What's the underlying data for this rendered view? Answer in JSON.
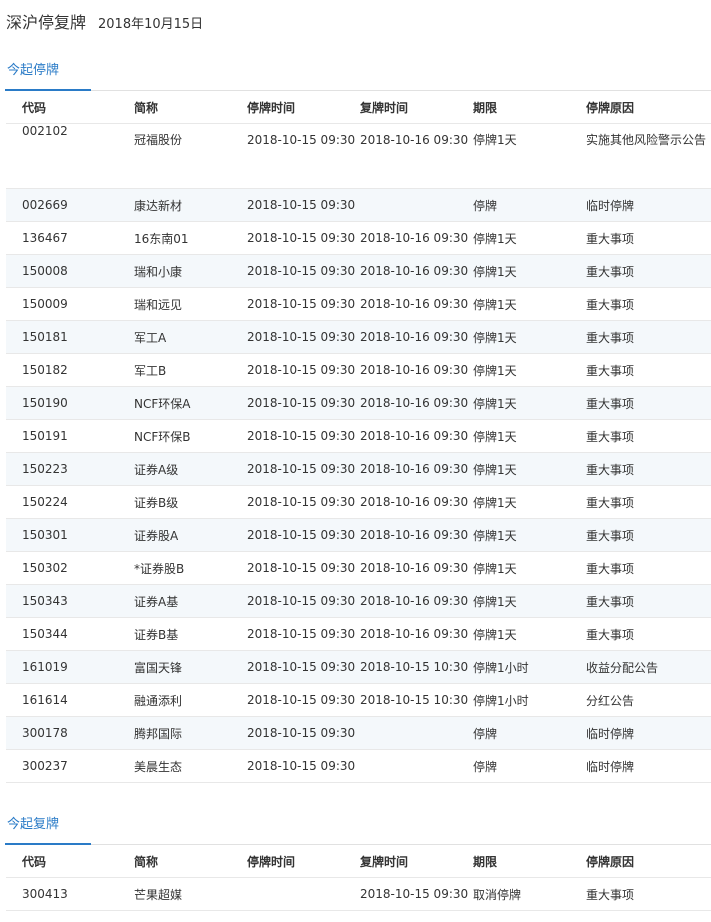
{
  "page": {
    "title": "深沪停复牌",
    "date": "2018年10月15日"
  },
  "columns": [
    "代码",
    "简称",
    "停牌时间",
    "复牌时间",
    "期限",
    "停牌原因"
  ],
  "suspended": {
    "tab_label": "今起停牌",
    "rows": [
      {
        "code": "002102",
        "name": "冠福股份",
        "suspend": "2018-10-15 09:30",
        "resume": "2018-10-16 09:30",
        "term": "停牌1天",
        "reason": "实施其他风险警示公告"
      },
      {
        "code": "002669",
        "name": "康达新材",
        "suspend": "2018-10-15 09:30",
        "resume": "",
        "term": "停牌",
        "reason": "临时停牌"
      },
      {
        "code": "136467",
        "name": "16东南01",
        "suspend": "2018-10-15 09:30",
        "resume": "2018-10-16 09:30",
        "term": "停牌1天",
        "reason": "重大事项"
      },
      {
        "code": "150008",
        "name": "瑞和小康",
        "suspend": "2018-10-15 09:30",
        "resume": "2018-10-16 09:30",
        "term": "停牌1天",
        "reason": "重大事项"
      },
      {
        "code": "150009",
        "name": "瑞和远见",
        "suspend": "2018-10-15 09:30",
        "resume": "2018-10-16 09:30",
        "term": "停牌1天",
        "reason": "重大事项"
      },
      {
        "code": "150181",
        "name": "军工A",
        "suspend": "2018-10-15 09:30",
        "resume": "2018-10-16 09:30",
        "term": "停牌1天",
        "reason": "重大事项"
      },
      {
        "code": "150182",
        "name": "军工B",
        "suspend": "2018-10-15 09:30",
        "resume": "2018-10-16 09:30",
        "term": "停牌1天",
        "reason": "重大事项"
      },
      {
        "code": "150190",
        "name": "NCF环保A",
        "suspend": "2018-10-15 09:30",
        "resume": "2018-10-16 09:30",
        "term": "停牌1天",
        "reason": "重大事项"
      },
      {
        "code": "150191",
        "name": "NCF环保B",
        "suspend": "2018-10-15 09:30",
        "resume": "2018-10-16 09:30",
        "term": "停牌1天",
        "reason": "重大事项"
      },
      {
        "code": "150223",
        "name": "证券A级",
        "suspend": "2018-10-15 09:30",
        "resume": "2018-10-16 09:30",
        "term": "停牌1天",
        "reason": "重大事项"
      },
      {
        "code": "150224",
        "name": "证券B级",
        "suspend": "2018-10-15 09:30",
        "resume": "2018-10-16 09:30",
        "term": "停牌1天",
        "reason": "重大事项"
      },
      {
        "code": "150301",
        "name": "证券股A",
        "suspend": "2018-10-15 09:30",
        "resume": "2018-10-16 09:30",
        "term": "停牌1天",
        "reason": "重大事项"
      },
      {
        "code": "150302",
        "name": "*证券股B",
        "suspend": "2018-10-15 09:30",
        "resume": "2018-10-16 09:30",
        "term": "停牌1天",
        "reason": "重大事项"
      },
      {
        "code": "150343",
        "name": "证券A基",
        "suspend": "2018-10-15 09:30",
        "resume": "2018-10-16 09:30",
        "term": "停牌1天",
        "reason": "重大事项"
      },
      {
        "code": "150344",
        "name": "证券B基",
        "suspend": "2018-10-15 09:30",
        "resume": "2018-10-16 09:30",
        "term": "停牌1天",
        "reason": "重大事项"
      },
      {
        "code": "161019",
        "name": "富国天锋",
        "suspend": "2018-10-15 09:30",
        "resume": "2018-10-15 10:30",
        "term": "停牌1小时",
        "reason": "收益分配公告"
      },
      {
        "code": "161614",
        "name": "融通添利",
        "suspend": "2018-10-15 09:30",
        "resume": "2018-10-15 10:30",
        "term": "停牌1小时",
        "reason": "分红公告"
      },
      {
        "code": "300178",
        "name": "腾邦国际",
        "suspend": "2018-10-15 09:30",
        "resume": "",
        "term": "停牌",
        "reason": "临时停牌"
      },
      {
        "code": "300237",
        "name": "美晨生态",
        "suspend": "2018-10-15 09:30",
        "resume": "",
        "term": "停牌",
        "reason": "临时停牌"
      }
    ]
  },
  "resumed": {
    "tab_label": "今起复牌",
    "rows": [
      {
        "code": "300413",
        "name": "芒果超媒",
        "suspend": "",
        "resume": "2018-10-15 09:30",
        "term": "取消停牌",
        "reason": "重大事项"
      }
    ]
  },
  "colors": {
    "accent": "#2a7bc7",
    "row_stripe": "#f4f8fb",
    "border": "#e8e8e8"
  }
}
